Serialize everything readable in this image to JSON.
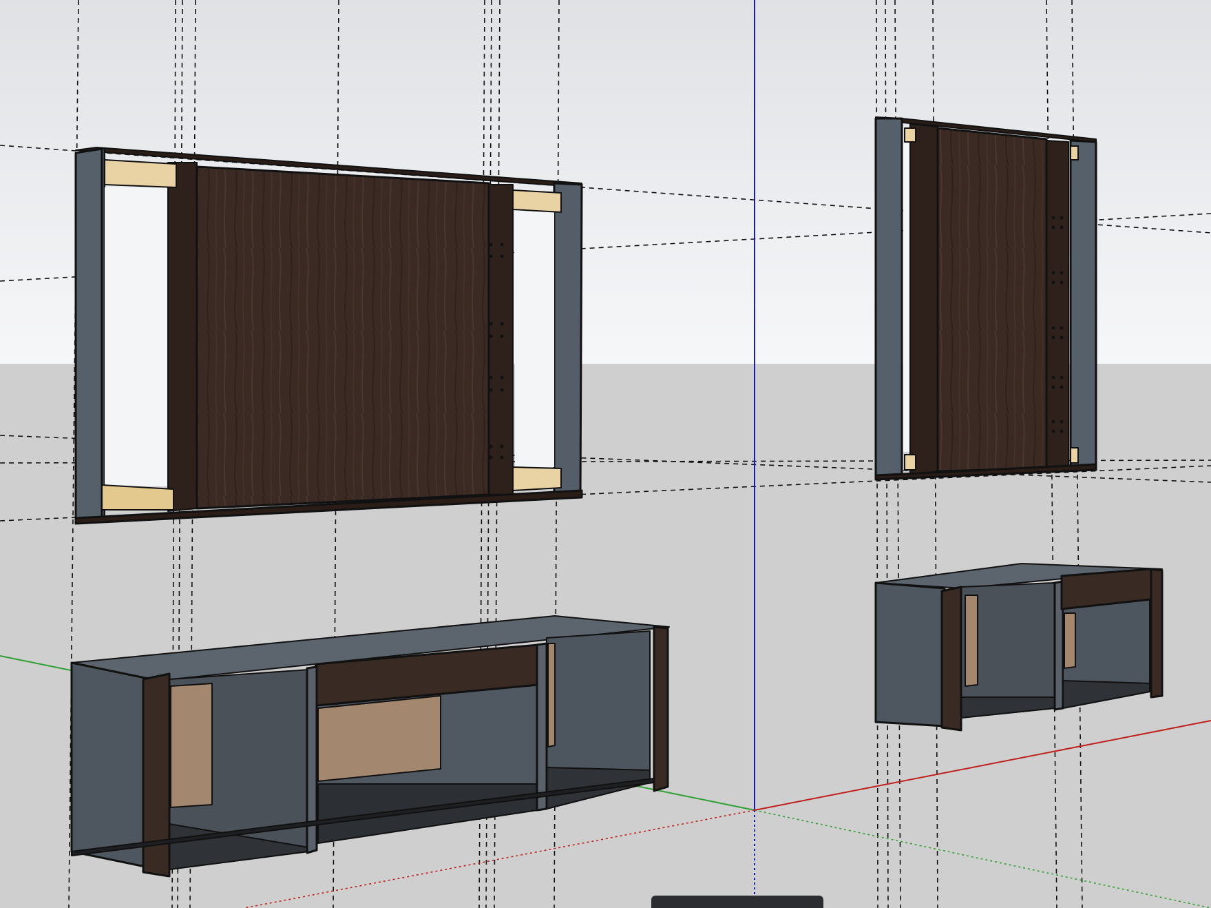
{
  "app": {
    "view": "perspective-3d-viewport",
    "colors": {
      "sky_top": "#e3e5e8",
      "sky_bottom": "#f5f6f8",
      "ground": "#cfcfcf",
      "axis_red": "#c0201c",
      "axis_green": "#2ea032",
      "axis_blue": "#1a1ab8",
      "cabinet_gray": "#4e545c",
      "cabinet_gray_light": "#5a616a",
      "cabinet_interior_dark": "#2f3237",
      "walnut": "#3a2a24",
      "walnut_dark": "#2a1d18",
      "blocking_pine": "#e9d3a4",
      "backer_tan": "#a3876f"
    },
    "icons": {
      "axis_origin": "axis-origin-icon"
    }
  },
  "model": {
    "objects": [
      "wall-frame-left",
      "wall-frame-right",
      "base-cabinet-left",
      "base-cabinet-right"
    ]
  },
  "status_bar": {
    "label": ""
  }
}
